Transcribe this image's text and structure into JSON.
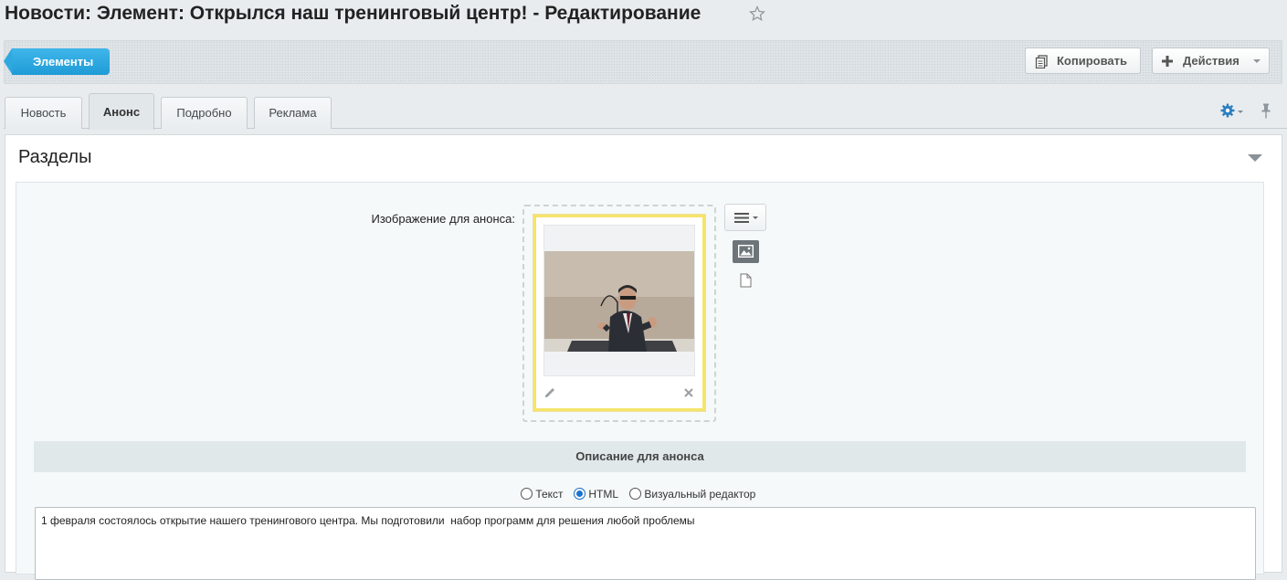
{
  "page": {
    "title": "Новости: Элемент: Открылся наш тренинговый центр! - Редактирование"
  },
  "toolbar": {
    "back_button": "Элементы",
    "copy_button": "Копировать",
    "actions_button": "Действия"
  },
  "tabs": [
    {
      "label": "Новость",
      "active": false
    },
    {
      "label": "Анонс",
      "active": true
    },
    {
      "label": "Подробно",
      "active": false
    },
    {
      "label": "Реклама",
      "active": false
    }
  ],
  "section": {
    "title": "Разделы"
  },
  "preview_image": {
    "label": "Изображение для анонса:"
  },
  "description": {
    "header": "Описание для анонса",
    "modes": [
      {
        "label": "Текст",
        "checked": false
      },
      {
        "label": "HTML",
        "checked": true
      },
      {
        "label": "Визуальный редактор",
        "checked": false
      }
    ],
    "text": "1 февраля состоялось открытие нашего тренингового центра. Мы подготовили  набор программ для решения любой проблемы"
  },
  "colors": {
    "accent_blue": "#1f9bd6",
    "image_highlight": "#f5e46a"
  },
  "icons": [
    "star-icon",
    "copy-icon",
    "plus-icon",
    "gear-icon",
    "pin-icon",
    "pencil-icon",
    "close-icon",
    "menu-icon",
    "image-icon",
    "file-icon"
  ]
}
